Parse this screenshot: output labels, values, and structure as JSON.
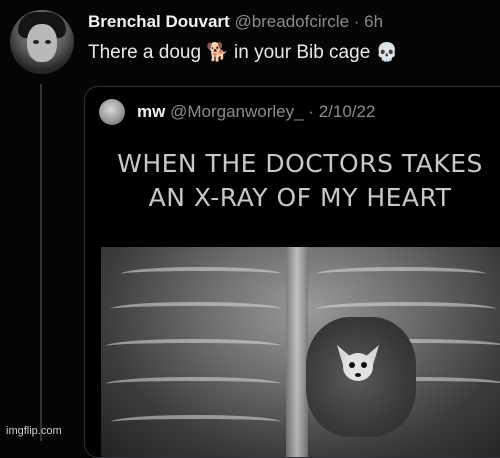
{
  "tweet": {
    "author_name": "Brenchal Douvart",
    "handle": "@breadofcircle",
    "separator": "·",
    "time": "6h",
    "text_before": "There a doug",
    "emoji_dog": "🐕",
    "text_after": "in your Bib cage",
    "emoji_skull": "💀"
  },
  "quote": {
    "author_name": "mw",
    "handle": "@Morganworley_",
    "separator": "·",
    "date": "2/10/22",
    "meme_line1": "WHEN THE DOCTORS TAKES",
    "meme_line2": "AN X-RAY OF MY HEART"
  },
  "watermark": "imgflip.com"
}
